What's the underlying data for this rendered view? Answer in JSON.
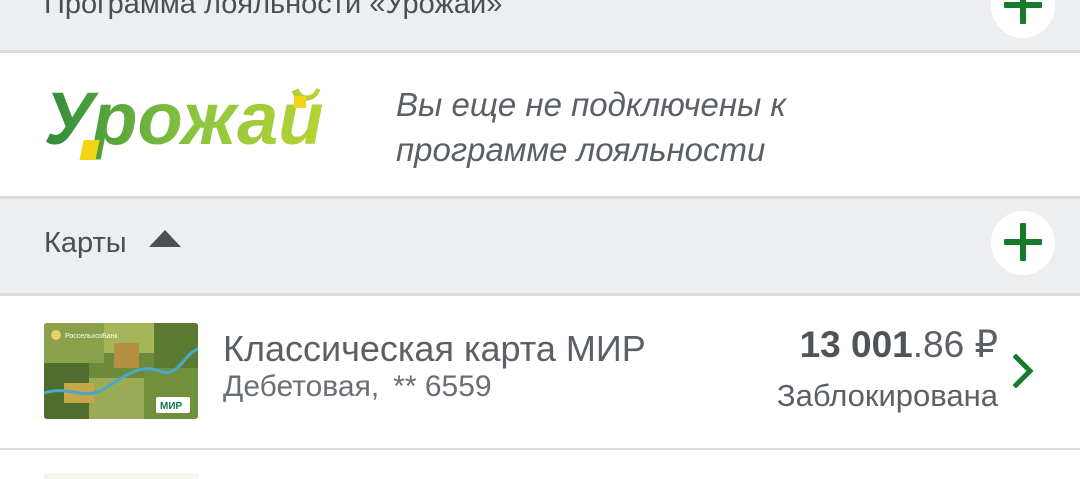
{
  "loyalty_section": {
    "title": "Программа лояльности «Урожай»",
    "logo_text": "Урожай",
    "message_line1": "Вы еще не подключены к",
    "message_line2": "программе лояльности"
  },
  "cards_section": {
    "title": "Карты"
  },
  "cards": [
    {
      "name": "Классическая карта МИР",
      "type": "Дебетовая,",
      "number_mask": "** 6559",
      "balance_whole": "13 001",
      "balance_fraction": ".86",
      "currency": "₽",
      "status": "Заблокирована",
      "thumb_bank_label": "РоссельхозБанк",
      "thumb_system_label": "МИР"
    }
  ],
  "colors": {
    "accent_green": "#167a2a",
    "header_bg": "#eceeef",
    "text_gray": "#5b6066"
  },
  "icons": {
    "add": "plus-icon",
    "collapse": "caret-up-icon",
    "open": "chevron-right-icon"
  }
}
